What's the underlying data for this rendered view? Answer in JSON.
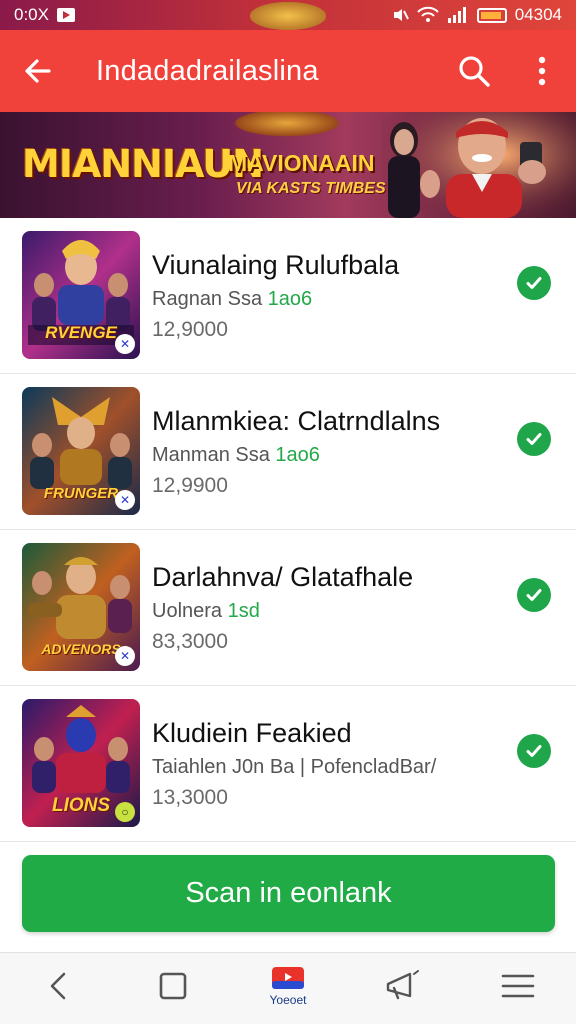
{
  "status_bar": {
    "time": "0:0X",
    "right_text": "04304",
    "colors": {
      "battery": "#ffb13a"
    }
  },
  "app_bar": {
    "title": "Indadadrailaslina",
    "background": "#f0423a"
  },
  "banner": {
    "title": "MIANNIAUN",
    "subtitle_1": "MAVIONAAIN",
    "subtitle_2": "VIA KASTS TIMBES"
  },
  "games": [
    {
      "title": "Viunalaing Rulufbala",
      "subtitle": "Ragnan Ssa",
      "tag": "1ao6",
      "count": "12,9000",
      "thumb_text": "RVENGE",
      "verified": true
    },
    {
      "title": "Mlanmkiea: Clatrndlalns",
      "subtitle": "Manman Ssa",
      "tag": "1ao6",
      "count": "12,9900",
      "thumb_text": "FRUNGER",
      "verified": true
    },
    {
      "title": "Darlahnva/ Glatafhale",
      "subtitle": "Uolnera",
      "tag": "1sd",
      "count": "83,3000",
      "thumb_text": "ADVENORS",
      "verified": true
    },
    {
      "title": "Kludiein Feakied",
      "subtitle": "Taiahlen J0n Ba | PofencladBar/",
      "tag": "",
      "count": "13,3000",
      "thumb_text": "LIONS",
      "verified": true
    }
  ],
  "cta": {
    "label": "Scan in eonlank",
    "color": "#20ab46"
  },
  "bottom_nav": {
    "items": [
      {
        "name": "back",
        "icon": "chevron-left-icon",
        "label": ""
      },
      {
        "name": "home",
        "icon": "square-icon",
        "label": ""
      },
      {
        "name": "store",
        "icon": "store-icon",
        "label": "Yoeoet"
      },
      {
        "name": "share",
        "icon": "megaphone-icon",
        "label": ""
      },
      {
        "name": "menu",
        "icon": "hamburger-icon",
        "label": ""
      }
    ]
  },
  "icons": {
    "back": "arrow-left-icon",
    "search": "search-icon",
    "more": "more-vertical-icon",
    "verified": "check-circle-icon"
  }
}
